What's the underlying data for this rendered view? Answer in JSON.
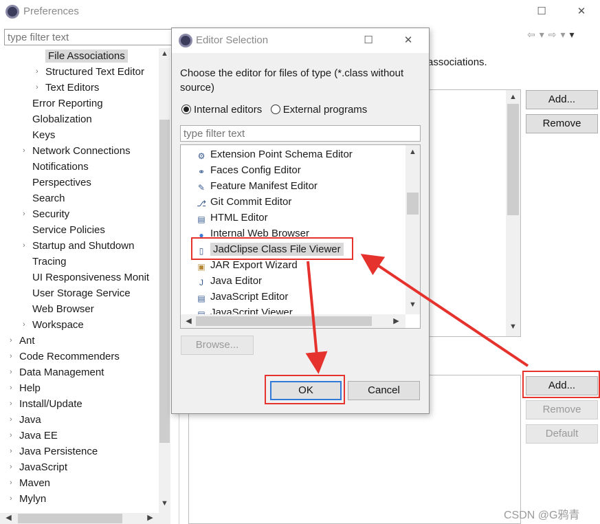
{
  "window": {
    "title": "Preferences",
    "minimize": "☐",
    "close": "✕"
  },
  "filter": {
    "placeholder": "type filter text"
  },
  "tree": [
    {
      "label": "File Associations",
      "arrow": "",
      "selected": true
    },
    {
      "label": "Structured Text Editor",
      "arrow": "›"
    },
    {
      "label": "Text Editors",
      "arrow": "›"
    },
    {
      "label": "Error Reporting",
      "arrow": ""
    },
    {
      "label": "Globalization",
      "arrow": ""
    },
    {
      "label": "Keys",
      "arrow": ""
    },
    {
      "label": "Network Connections",
      "arrow": "›"
    },
    {
      "label": "Notifications",
      "arrow": ""
    },
    {
      "label": "Perspectives",
      "arrow": ""
    },
    {
      "label": "Search",
      "arrow": ""
    },
    {
      "label": "Security",
      "arrow": "›"
    },
    {
      "label": "Service Policies",
      "arrow": ""
    },
    {
      "label": "Startup and Shutdown",
      "arrow": "›"
    },
    {
      "label": "Tracing",
      "arrow": ""
    },
    {
      "label": "UI Responsiveness Monit",
      "arrow": ""
    },
    {
      "label": "User Storage Service",
      "arrow": ""
    },
    {
      "label": "Web Browser",
      "arrow": ""
    },
    {
      "label": "Workspace",
      "arrow": "›"
    },
    {
      "label": "Ant",
      "arrow": "›"
    },
    {
      "label": "Code Recommenders",
      "arrow": "›"
    },
    {
      "label": "Data Management",
      "arrow": "›"
    },
    {
      "label": "Help",
      "arrow": "›"
    },
    {
      "label": "Install/Update",
      "arrow": "›"
    },
    {
      "label": "Java",
      "arrow": "›"
    },
    {
      "label": "Java EE",
      "arrow": "›"
    },
    {
      "label": "Java Persistence",
      "arrow": "›"
    },
    {
      "label": "JavaScript",
      "arrow": "›"
    },
    {
      "label": "Maven",
      "arrow": "›"
    },
    {
      "label": "Mylyn",
      "arrow": "›"
    }
  ],
  "right": {
    "assoc_text": "associations.",
    "add_top": "Add...",
    "remove_top": "Remove",
    "add_bottom": "Add...",
    "remove_bottom": "Remove",
    "default_bottom": "Default"
  },
  "dialog": {
    "title": "Editor Selection",
    "maximize": "☐",
    "close": "✕",
    "prompt": "Choose the editor for files of type (*.class without source)",
    "radio_internal": "Internal editors",
    "radio_external": "External programs",
    "filter_placeholder": "type filter text",
    "editors": [
      {
        "label": "Extension Point Schema Editor",
        "icon": "schema-editor-icon",
        "glyph": "⚙"
      },
      {
        "label": "Faces Config Editor",
        "icon": "faces-config-icon",
        "glyph": "⚭"
      },
      {
        "label": "Feature Manifest Editor",
        "icon": "feature-manifest-icon",
        "glyph": "✎"
      },
      {
        "label": "Git Commit Editor",
        "icon": "git-commit-icon",
        "glyph": "⎇"
      },
      {
        "label": "HTML Editor",
        "icon": "html-editor-icon",
        "glyph": "▤"
      },
      {
        "label": "Internal Web Browser",
        "icon": "globe-icon",
        "glyph": "●"
      },
      {
        "label": "JadClipse Class File Viewer",
        "icon": "class-file-icon",
        "glyph": "▯",
        "selected": true
      },
      {
        "label": "JAR Export Wizard",
        "icon": "jar-icon",
        "glyph": "▣"
      },
      {
        "label": "Java Editor",
        "icon": "java-file-icon",
        "glyph": "J"
      },
      {
        "label": "JavaScript Editor",
        "icon": "javascript-file-icon",
        "glyph": "▤"
      },
      {
        "label": "JavaScript Viewer",
        "icon": "javascript-viewer-icon",
        "glyph": "▤"
      }
    ],
    "browse": "Browse...",
    "ok": "OK",
    "cancel": "Cancel"
  },
  "watermark": "CSDN @G鸦青",
  "colors": {
    "highlight_red": "#e5322d",
    "focus_blue": "#2f78d6"
  }
}
